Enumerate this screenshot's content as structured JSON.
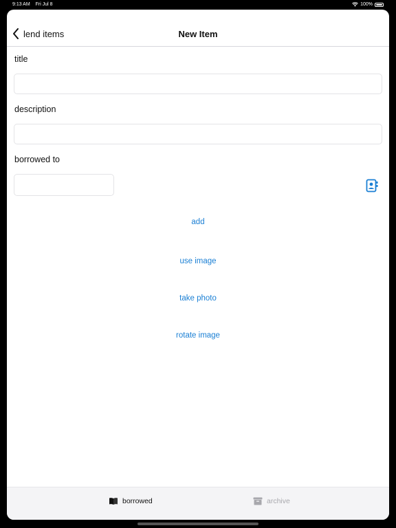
{
  "status_bar": {
    "time": "9:13 AM",
    "date": "Fri Jul 8",
    "battery": "100%"
  },
  "nav": {
    "back_label": "lend items",
    "title": "New Item"
  },
  "form": {
    "title_label": "title",
    "title_value": "",
    "description_label": "description",
    "description_value": "",
    "borrowed_to_label": "borrowed to",
    "borrowed_to_value": ""
  },
  "actions": {
    "add": "add",
    "use_image": "use image",
    "take_photo": "take photo",
    "rotate_image": "rotate image"
  },
  "tabs": [
    {
      "label": "borrowed",
      "icon": "book-icon",
      "active": true
    },
    {
      "label": "archive",
      "icon": "archive-box-icon",
      "active": false
    }
  ],
  "colors": {
    "accent": "#1a7fd4",
    "inactive_tab": "#a8a8ad"
  }
}
